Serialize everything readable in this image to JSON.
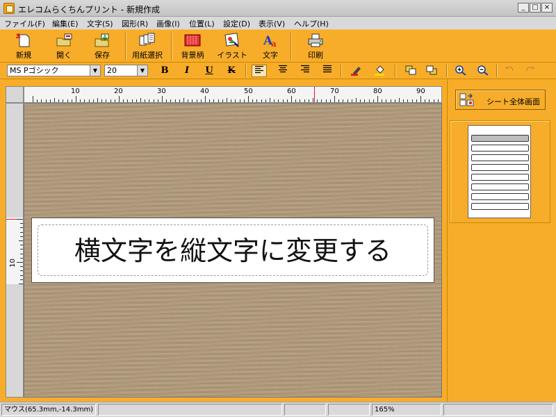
{
  "window": {
    "title": "エレコムらくちんプリント - 新規作成",
    "controls": [
      "_",
      "□",
      "×"
    ]
  },
  "menu": [
    "ファイル(F)",
    "編集(E)",
    "文字(S)",
    "図形(R)",
    "画像(I)",
    "位置(L)",
    "設定(D)",
    "表示(V)",
    "ヘルプ(H)"
  ],
  "toolbar": {
    "new": "新規",
    "open": "開く",
    "save": "保存",
    "paper_select": "用紙選択",
    "background": "背景柄",
    "illustration": "イラスト",
    "text": "文字",
    "print": "印刷"
  },
  "format": {
    "font_name": "MS Pゴシック",
    "font_size": "20",
    "bold": "B",
    "italic": "I",
    "underline": "U",
    "strike": "K"
  },
  "ruler": {
    "h_labels": [
      "10",
      "20",
      "30",
      "40",
      "50",
      "60",
      "70",
      "80",
      "90"
    ],
    "v_label": "10"
  },
  "label": {
    "text": "横文字を縦文字に変更する"
  },
  "sidebar": {
    "sheet_button": "シート全体画面"
  },
  "status": {
    "mouse": "マウス(65.3mm,-14.3mm)",
    "zoom": "165%"
  },
  "colors": {
    "toolbar": "#f7ad2a",
    "canvas": "#b0997a"
  }
}
